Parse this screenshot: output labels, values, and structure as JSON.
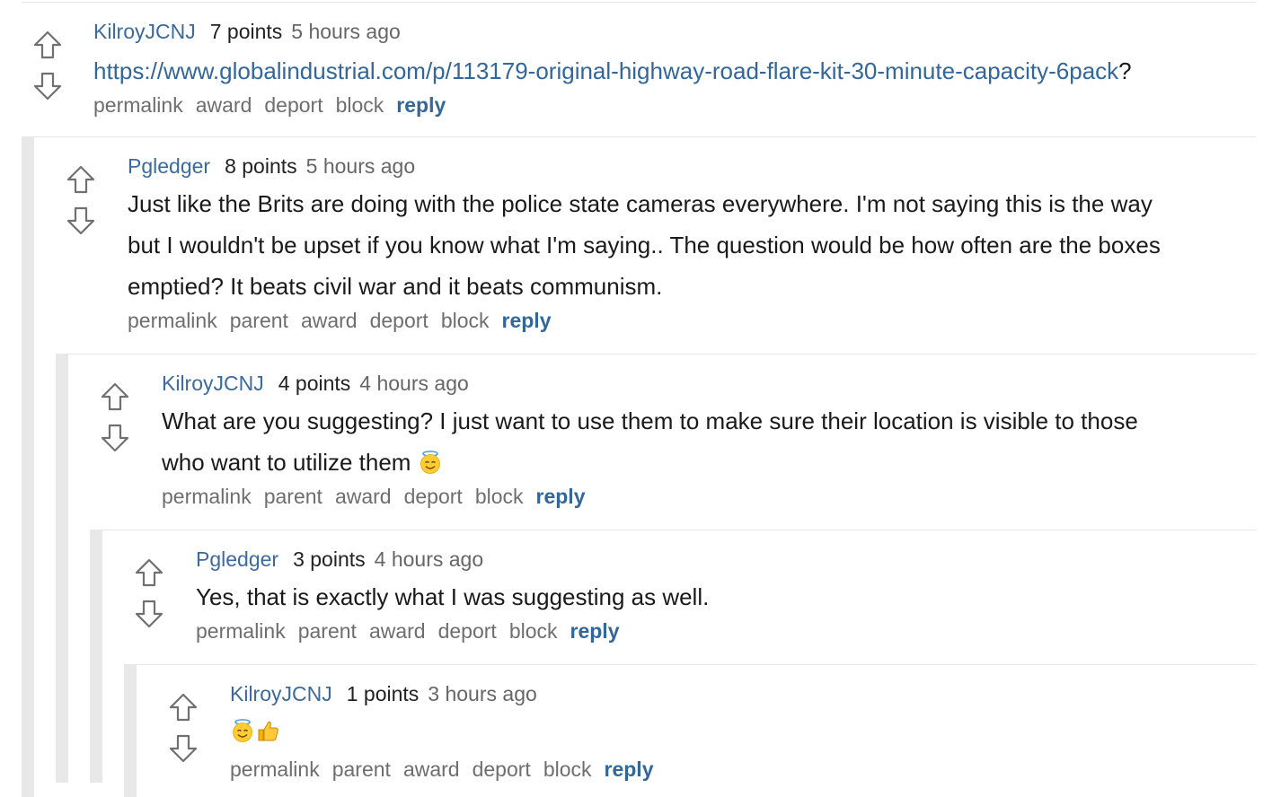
{
  "comments": [
    {
      "author": "KilroyJCNJ",
      "points": "7 points",
      "time": "5 hours ago",
      "link": "https://www.globalindustrial.com/p/113179-original-highway-road-flare-kit-30-minute-capacity-6pack",
      "link_suffix": "?",
      "actions": {
        "permalink": "permalink",
        "award": "award",
        "deport": "deport",
        "block": "block",
        "reply": "reply"
      }
    },
    {
      "author": "Pgledger",
      "points": "8 points",
      "time": "5 hours ago",
      "text_lines": [
        "Just like the Brits are doing with the police state cameras everywhere. I'm not saying this is the way",
        "but I wouldn't be upset if you know what I'm saying.. The question would be how often are the boxes",
        "emptied? It beats civil war and it beats communism."
      ],
      "actions": {
        "permalink": "permalink",
        "parent": "parent",
        "award": "award",
        "deport": "deport",
        "block": "block",
        "reply": "reply"
      }
    },
    {
      "author": "KilroyJCNJ",
      "points": "4 points",
      "time": "4 hours ago",
      "text_lines": [
        "What are you suggesting? I just want to use them to make sure their location is visible to those",
        "who want to utilize them"
      ],
      "text_emoji": "smiling-face-with-halo",
      "actions": {
        "permalink": "permalink",
        "parent": "parent",
        "award": "award",
        "deport": "deport",
        "block": "block",
        "reply": "reply"
      }
    },
    {
      "author": "Pgledger",
      "points": "3 points",
      "time": "4 hours ago",
      "text_lines": [
        "Yes, that is exactly what I was suggesting as well."
      ],
      "actions": {
        "permalink": "permalink",
        "parent": "parent",
        "award": "award",
        "deport": "deport",
        "block": "block",
        "reply": "reply"
      }
    },
    {
      "author": "KilroyJCNJ",
      "points": "1 points",
      "time": "3 hours ago",
      "text_emojis": [
        "smiling-face-with-halo",
        "thumbs-up"
      ],
      "actions": {
        "permalink": "permalink",
        "parent": "parent",
        "award": "award",
        "deport": "deport",
        "block": "block",
        "reply": "reply"
      }
    }
  ],
  "colors": {
    "author": "#3a6a9e",
    "link": "#336699",
    "reply": "#336699",
    "action": "#6e6e6e",
    "thread_rail": "#e8e8e8",
    "separator": "#e6e6e6"
  },
  "icons": {
    "upvote": "upvote-arrow-icon",
    "downvote": "downvote-arrow-icon"
  }
}
